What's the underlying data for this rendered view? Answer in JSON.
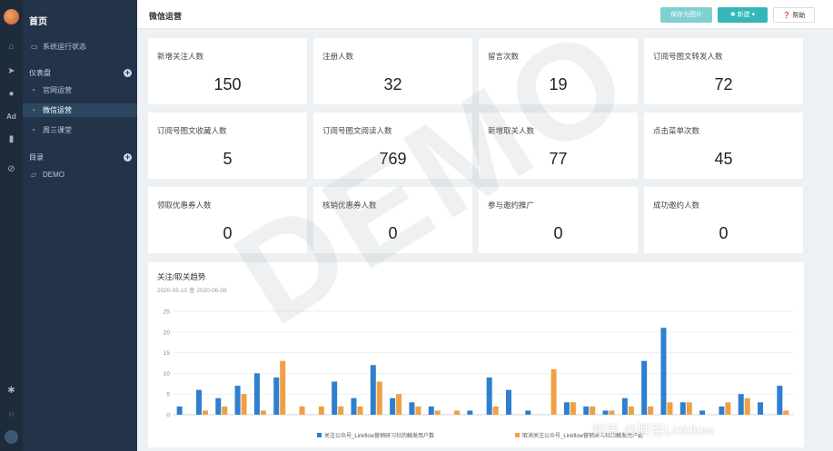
{
  "app": {
    "page_title": "微信运营"
  },
  "toolbar": {
    "save_label": "保存为图片",
    "new_label": "新建",
    "help_label": "帮助"
  },
  "sidebar": {
    "home": "首页",
    "items": [
      {
        "label": "系统运行状态",
        "icon": "monitor-icon"
      },
      {
        "label": "官网运营",
        "icon": "gauge-icon"
      },
      {
        "label": "微信运营",
        "icon": "gauge-icon",
        "active": true
      },
      {
        "label": "周三课堂",
        "icon": "gauge-icon"
      },
      {
        "label": "DEMO",
        "icon": "folder-icon"
      }
    ],
    "sections": {
      "dashboard": "仪表盘",
      "catalog": "目录"
    }
  },
  "stats": [
    {
      "label": "新增关注人数",
      "value": "150"
    },
    {
      "label": "注册人数",
      "value": "32"
    },
    {
      "label": "留言次数",
      "value": "19"
    },
    {
      "label": "订阅号图文转发人数",
      "value": "72"
    },
    {
      "label": "订阅号图文收藏人数",
      "value": "5"
    },
    {
      "label": "订阅号图文阅读人数",
      "value": "769"
    },
    {
      "label": "新增取关人数",
      "value": "77"
    },
    {
      "label": "点击菜单次数",
      "value": "45"
    },
    {
      "label": "领取优惠券人数",
      "value": "0"
    },
    {
      "label": "核销优惠券人数",
      "value": "0"
    },
    {
      "label": "参与邀约推广",
      "value": "0"
    },
    {
      "label": "成功邀约人数",
      "value": "0"
    }
  ],
  "chart_data": {
    "type": "bar",
    "title": "关注/取关趋势",
    "subtitle": "2020-05-10 至 2020-06-08",
    "ylim": [
      0,
      25
    ],
    "yticks": [
      0,
      5,
      10,
      15,
      20,
      25
    ],
    "grid": true,
    "legend_position": "bottom",
    "colors": {
      "follow": "#2f7fce",
      "unfollow": "#f0a044"
    },
    "series": [
      {
        "name": "关注公众号_Linkflow营销研习社的触发用户数",
        "values": [
          2,
          6,
          4,
          7,
          10,
          9,
          0,
          0,
          8,
          4,
          12,
          4,
          3,
          2,
          0,
          1,
          9,
          6,
          1,
          0,
          3,
          2,
          1,
          4,
          13,
          21,
          3,
          1,
          2,
          5,
          3,
          7
        ]
      },
      {
        "name": "取消关注公众号_Linkflow营销研习社的触发用户数",
        "values": [
          0,
          1,
          2,
          5,
          1,
          13,
          2,
          2,
          2,
          2,
          8,
          5,
          2,
          1,
          1,
          0,
          2,
          0,
          0,
          11,
          3,
          2,
          1,
          2,
          2,
          3,
          3,
          0,
          3,
          4,
          0,
          1
        ]
      }
    ]
  },
  "watermarks": {
    "demo": "DEMO",
    "credit": "知乎 @联否Linkflow"
  }
}
